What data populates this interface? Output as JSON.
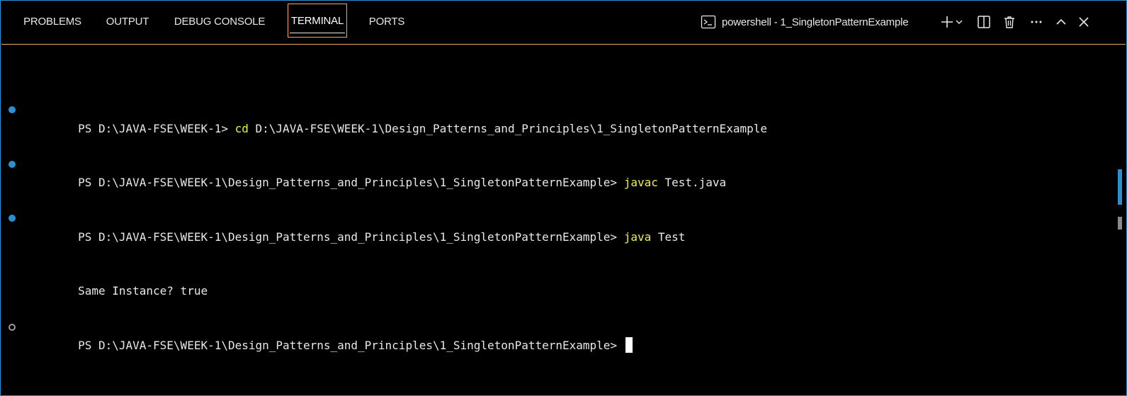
{
  "tabs": [
    {
      "label": "PROBLEMS"
    },
    {
      "label": "OUTPUT"
    },
    {
      "label": "DEBUG CONSOLE"
    },
    {
      "label": "TERMINAL"
    },
    {
      "label": "PORTS"
    }
  ],
  "active_tab": "TERMINAL",
  "terminal_selector": {
    "label": "powershell - 1_SingletonPatternExample",
    "icon": "terminal-powershell-icon"
  },
  "actions": {
    "new_terminal_icon": "plus-icon",
    "launch_profile_icon": "chevron-down-icon",
    "split_icon": "split-terminal-icon",
    "kill_icon": "trash-icon",
    "more_icon": "ellipsis-icon",
    "maximize_icon": "chevron-up-icon",
    "close_icon": "close-icon"
  },
  "terminal": {
    "lines": [
      {
        "decoration": "success",
        "prompt": "PS D:\\JAVA-FSE\\WEEK-1> ",
        "command": "cd",
        "args": " D:\\JAVA-FSE\\WEEK-1\\Design_Patterns_and_Principles\\1_SingletonPatternExample"
      },
      {
        "decoration": "success",
        "prompt": "PS D:\\JAVA-FSE\\WEEK-1\\Design_Patterns_and_Principles\\1_SingletonPatternExample> ",
        "command": "javac",
        "args": " Test.java"
      },
      {
        "decoration": "success",
        "prompt": "PS D:\\JAVA-FSE\\WEEK-1\\Design_Patterns_and_Principles\\1_SingletonPatternExample> ",
        "command": "java",
        "args": " Test"
      },
      {
        "decoration": "none",
        "output": "Same Instance? true"
      },
      {
        "decoration": "empty",
        "prompt": "PS D:\\JAVA-FSE\\WEEK-1\\Design_Patterns_and_Principles\\1_SingletonPatternExample> ",
        "cursor": true
      }
    ]
  },
  "colors": {
    "accent_blue": "#2b8fd0",
    "active_tab_border": "#f0a860",
    "command_yellow": "#f0f040",
    "text": "#e8e8e8",
    "background": "#000000"
  }
}
